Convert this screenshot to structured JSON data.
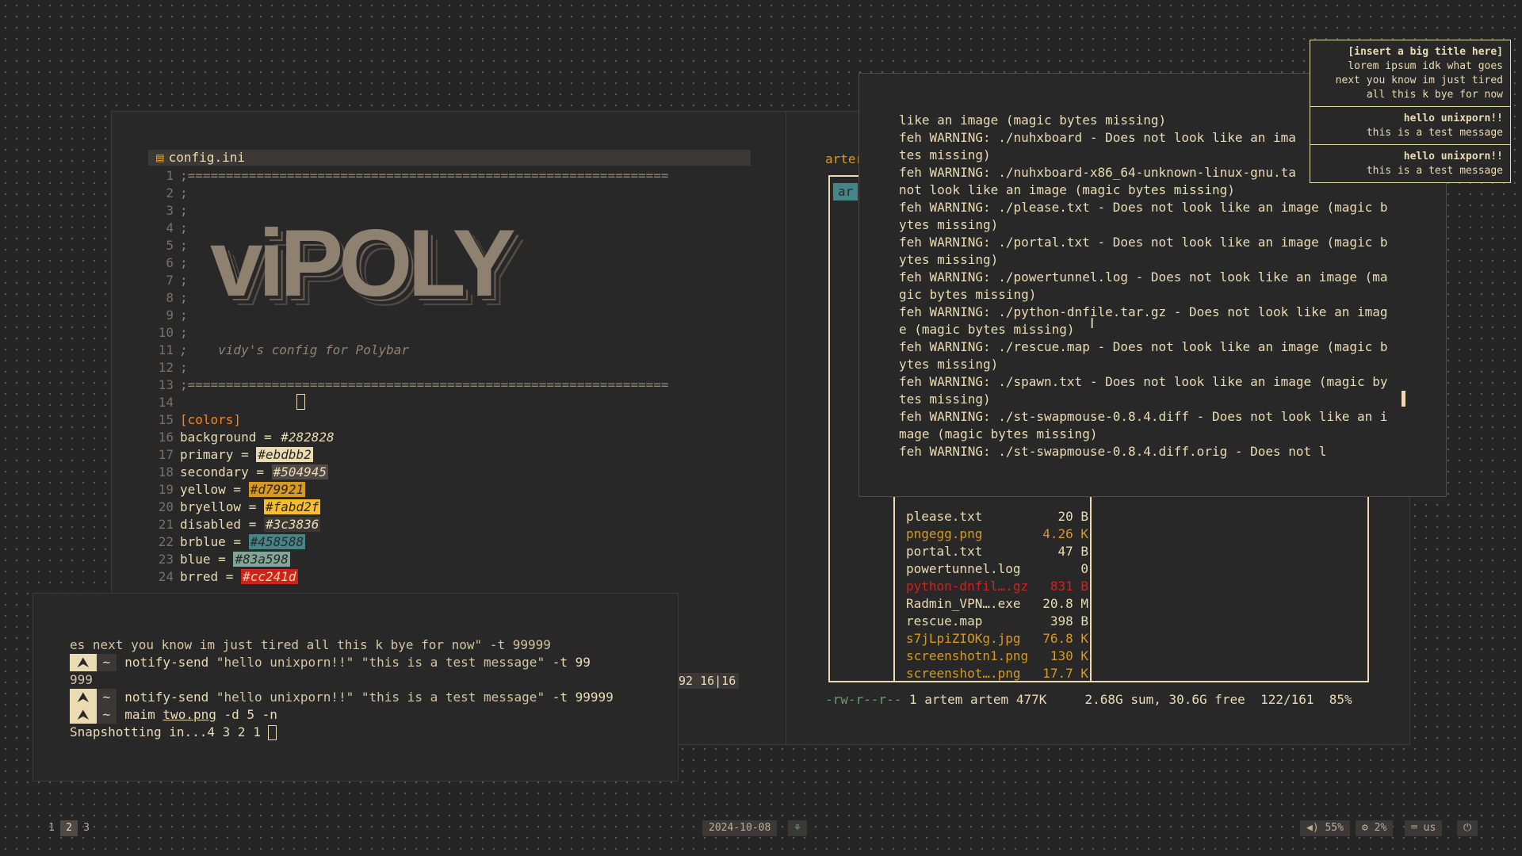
{
  "editor": {
    "tab_icon": "file-icon",
    "tab_title": "config.ini",
    "logo_text": "viPOLY",
    "lines": [
      {
        "n": "1",
        "text": ";==============================================================="
      },
      {
        "n": "2",
        "text": ";"
      },
      {
        "n": "3",
        "text": ";"
      },
      {
        "n": "4",
        "text": ";"
      },
      {
        "n": "5",
        "text": ";"
      },
      {
        "n": "6",
        "text": ";"
      },
      {
        "n": "7",
        "text": ";"
      },
      {
        "n": "8",
        "text": ";"
      },
      {
        "n": "9",
        "text": ";"
      },
      {
        "n": "10",
        "text": ";"
      },
      {
        "n": "11",
        "text": ";    vidy's config for Polybar"
      },
      {
        "n": "12",
        "text": ";"
      },
      {
        "n": "13",
        "text": ";==============================================================="
      },
      {
        "n": "14",
        "text": ""
      },
      {
        "n": "15",
        "text": "[colors]"
      }
    ],
    "colors": [
      {
        "n": "16",
        "key": "background",
        "value": "#282828",
        "bg": "transparent",
        "fg": "#ebdbb2"
      },
      {
        "n": "17",
        "key": "primary",
        "value": "#ebdbb2",
        "bg": "#ebdbb2",
        "fg": "#282828"
      },
      {
        "n": "18",
        "key": "secondary",
        "value": "#504945",
        "bg": "#504945",
        "fg": "#ebdbb2"
      },
      {
        "n": "19",
        "key": "yellow",
        "value": "#d79921",
        "bg": "#d79921",
        "fg": "#282828"
      },
      {
        "n": "20",
        "key": "bryellow",
        "value": "#fabd2f",
        "bg": "#fabd2f",
        "fg": "#282828"
      },
      {
        "n": "21",
        "key": "disabled",
        "value": "#3c3836",
        "bg": "#3c3836",
        "fg": "#ebdbb2"
      },
      {
        "n": "22",
        "key": "brblue",
        "value": "#458588",
        "bg": "#458588",
        "fg": "#282828"
      },
      {
        "n": "23",
        "key": "blue",
        "value": "#83a598",
        "bg": "#83a598",
        "fg": "#282828"
      },
      {
        "n": "24",
        "key": "brred",
        "value": "#cc241d",
        "bg": "#cc241d",
        "fg": "#ebdbb2"
      }
    ],
    "statusline": "92 16|16"
  },
  "terminal": {
    "lines": [
      {
        "kind": "text",
        "text": "es next you know im just tired all this k bye for now\" -t 99999"
      },
      {
        "kind": "cmd",
        "prompt": "⮝",
        "tilde": "~",
        "cmd": "notify-send",
        "args": "\"hello unixporn!!\" \"this is a test message\"",
        "rest": " -t 99"
      },
      {
        "kind": "text",
        "text": "999"
      },
      {
        "kind": "cmd",
        "prompt": "⮝",
        "tilde": "~",
        "cmd": "notify-send",
        "args": "\"hello unixporn!!\" \"this is a test message\"",
        "rest": " -t 99999"
      },
      {
        "kind": "cmd2",
        "prompt": "⮝",
        "tilde": "~",
        "cmd": "maim",
        "file": "two.png",
        "rest": " -d 5 -n"
      }
    ],
    "last_line": "Snapshotting in...4 3 2 1 "
  },
  "filemanager": {
    "title": "arter",
    "selected": "ar",
    "files": [
      {
        "name": "please.txt",
        "size": "20 B",
        "color": "#ebdbb2"
      },
      {
        "name": "pngegg.png",
        "size": "4.26 K",
        "color": "#d79921"
      },
      {
        "name": "portal.txt",
        "size": "47 B",
        "color": "#ebdbb2"
      },
      {
        "name": "powertunnel.log",
        "size": "0",
        "color": "#ebdbb2"
      },
      {
        "name": "python-dnfil….gz",
        "size": "831 B",
        "color": "#cc241d"
      },
      {
        "name": "Radmin_VPN….exe",
        "size": "20.8 M",
        "color": "#ebdbb2"
      },
      {
        "name": "rescue.map",
        "size": "398 B",
        "color": "#ebdbb2"
      },
      {
        "name": "s7jLpiZIOKg.jpg",
        "size": "76.8 K",
        "color": "#d79921"
      },
      {
        "name": "screenshotn1.png",
        "size": "130 K",
        "color": "#d79921"
      },
      {
        "name": "screenshot….png",
        "size": "17.7 K",
        "color": "#d79921"
      }
    ],
    "status_perm": "-rw-r--r--",
    "status_rest": " 1 artem artem 477K     2.68G sum, 30.6G free  122/161  85%"
  },
  "feh": {
    "lines": [
      "like an image (magic bytes missing)",
      "feh WARNING: ./nuhxboard - Does not look like an ima",
      "tes missing)",
      "feh WARNING: ./nuhxboard-x86_64-unknown-linux-gnu.ta",
      "not look like an image (magic bytes missing)",
      "feh WARNING: ./please.txt - Does not look like an image (magic b",
      "ytes missing)",
      "feh WARNING: ./portal.txt - Does not look like an image (magic b",
      "ytes missing)",
      "feh WARNING: ./powertunnel.log - Does not look like an image (ma",
      "gic bytes missing)",
      "feh WARNING: ./python-dnfile.tar.gz - Does not look like an imag",
      "e (magic bytes missing)",
      "feh WARNING: ./rescue.map - Does not look like an image (magic b",
      "ytes missing)",
      "feh WARNING: ./spawn.txt - Does not look like an image (magic by",
      "tes missing)",
      "feh WARNING: ./st-swapmouse-0.8.4.diff - Does not look like an i",
      "mage (magic bytes missing)",
      "feh WARNING: ./st-swapmouse-0.8.4.diff.orig - Does not l"
    ]
  },
  "notifications": [
    {
      "title": "[insert a big title here]",
      "body": [
        "lorem ipsum idk what goes",
        "next you know im just tired",
        "all this k bye for now"
      ]
    },
    {
      "title": "hello unixporn!!",
      "body": [
        "this is a test message"
      ]
    },
    {
      "title": "hello unixporn!!",
      "body": [
        "this is a test message"
      ]
    }
  ],
  "polybar": {
    "workspaces": [
      {
        "label": "1",
        "active": false
      },
      {
        "label": "2",
        "active": true
      },
      {
        "label": "3",
        "active": false
      }
    ],
    "date": "2024-10-08",
    "tray_icon": "tree-icon",
    "volume_icon": "speaker-icon",
    "volume": "55%",
    "cpu_icon": "cpu-icon",
    "cpu": "2%",
    "keyboard_icon": "keyboard-icon",
    "layout": "us",
    "power_icon": "power-icon"
  }
}
